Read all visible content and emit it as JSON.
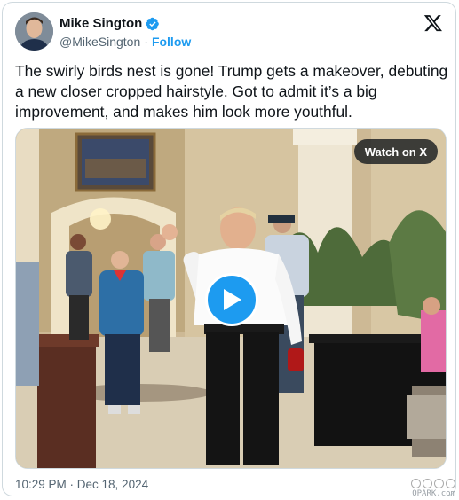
{
  "author": {
    "name": "Mike Sington",
    "handle": "@MikeSington",
    "separator": "·",
    "follow_label": "Follow",
    "verified": true,
    "avatar_icon": "avatar"
  },
  "tweet": {
    "text": "The swirly birds nest is gone! Trump gets a makeover, debuting a new closer cropped hairstyle. Got to admit it’s a big improvement, and makes him look more youthful.",
    "timestamp": "10:29 PM · Dec 18, 2024"
  },
  "media": {
    "watch_label": "Watch on X",
    "play_icon": "play-icon"
  },
  "watermark": {
    "text": "OPARK.com"
  },
  "colors": {
    "accent": "#1d9bf0",
    "text": "#0f1419",
    "muted": "#536471",
    "border": "#cfd9de"
  }
}
